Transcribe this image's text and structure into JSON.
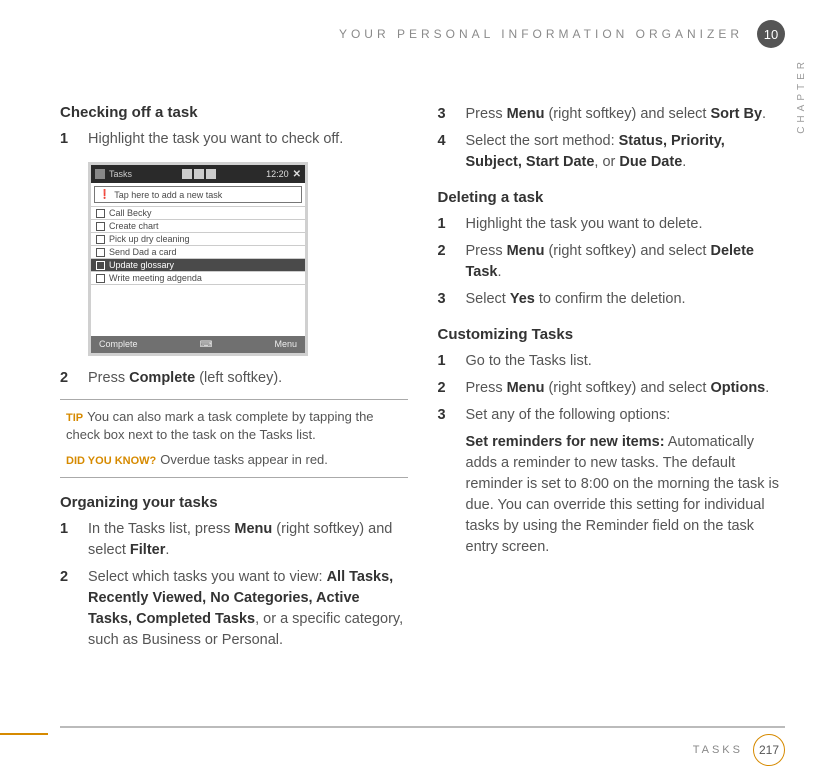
{
  "header": {
    "title": "YOUR PERSONAL INFORMATION ORGANIZER",
    "chapter_num": "10",
    "chapter_word": "CHAPTER"
  },
  "footer": {
    "section": "TASKS",
    "page": "217"
  },
  "left": {
    "s1_title": "Checking off a task",
    "s1_step1": "Highlight the task you want to check off.",
    "screenshot": {
      "time": "12:20",
      "input_hint": "Tap here to add a new task",
      "tasks": [
        "Call Becky",
        "Create chart",
        "Pick up dry cleaning",
        "Send Dad a card",
        "Update glossary",
        "Write meeting adgenda"
      ],
      "foot_left": "Complete",
      "foot_right": "Menu"
    },
    "s1_step2_pre": "Press ",
    "s1_step2_b": "Complete",
    "s1_step2_post": " (left softkey).",
    "tip": {
      "lbl1": "TIP",
      "t1": "You can also mark a task complete by tapping the check box next to the task on the Tasks list.",
      "lbl2": "DID YOU KNOW?",
      "t2": "Overdue tasks appear in red."
    },
    "s2_title": "Organizing your tasks",
    "s2_step1_a": "In the Tasks list, press ",
    "s2_step1_b": "Menu",
    "s2_step1_c": " (right softkey) and select ",
    "s2_step1_d": "Filter",
    "s2_step1_e": ".",
    "s2_step2_a": "Select which tasks you want to view: ",
    "s2_step2_opts": "All Tasks, Recently Viewed, No Categories, Active Tasks, Completed Tasks",
    "s2_step2_b": ", or a specific category, such as Business or Personal."
  },
  "right": {
    "r3_a": "Press ",
    "r3_b": "Menu",
    "r3_c": " (right softkey) and select ",
    "r3_d": "Sort By",
    "r3_e": ".",
    "r4_a": "Select the sort method: ",
    "r4_opts": "Status, Priority, Subject, Start Date",
    "r4_or": ", or ",
    "r4_last": "Due Date",
    "r4_e": ".",
    "s3_title": "Deleting a task",
    "d1": "Highlight the task you want to delete.",
    "d2_a": "Press ",
    "d2_b": "Menu",
    "d2_c": " (right softkey) and select ",
    "d2_d": "Delete Task",
    "d2_e": ".",
    "d3_a": "Select ",
    "d3_b": "Yes",
    "d3_c": " to confirm the deletion.",
    "s4_title": "Customizing Tasks",
    "c1": "Go to the Tasks list.",
    "c2_a": "Press ",
    "c2_b": "Menu",
    "c2_c": " (right softkey) and select ",
    "c2_d": "Options",
    "c2_e": ".",
    "c3": "Set any of the following options:",
    "c3_sub_b": "Set reminders for new items:",
    "c3_sub": " Automatically adds a reminder to new tasks. The default reminder is set to 8:00 on the morning the task is due. You can override this setting for individual tasks by using the Reminder field on the task entry screen."
  }
}
